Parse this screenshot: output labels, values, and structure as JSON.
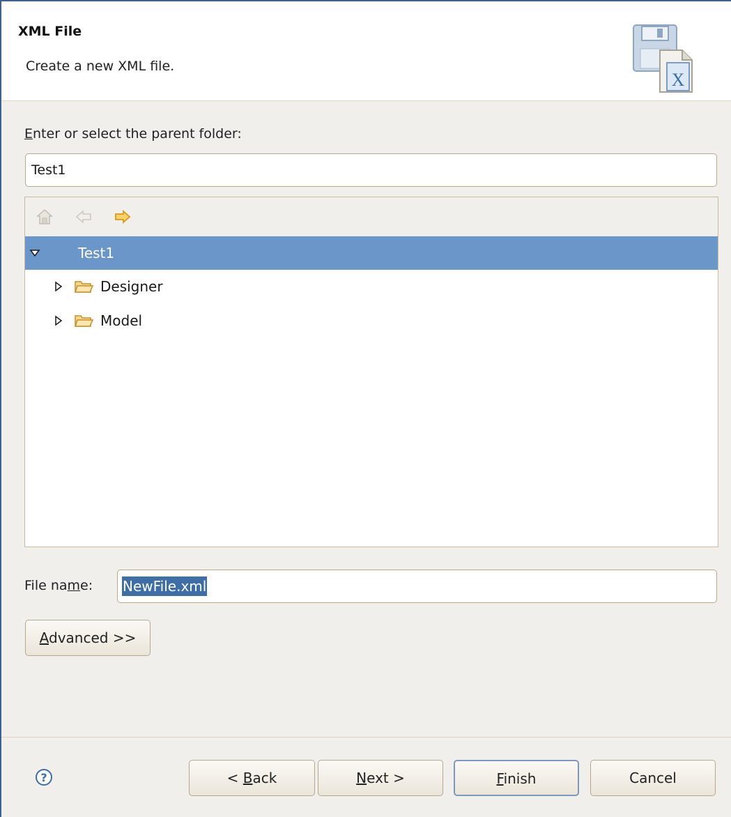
{
  "banner": {
    "title": "XML File",
    "description": "Create a new XML file.",
    "icon": "xml-file-wizard-icon"
  },
  "parent_folder": {
    "label_prefix": "",
    "label_mnemonic": "E",
    "label_rest": "nter or select the parent folder:",
    "value": "Test1"
  },
  "tree": {
    "toolbar": {
      "home_icon": "home-icon",
      "back_icon": "back-arrow-icon",
      "forward_icon": "forward-arrow-icon"
    },
    "items": [
      {
        "label": "Test1",
        "expanded": true,
        "selected": true
      },
      {
        "label": "Designer",
        "expanded": false,
        "selected": false
      },
      {
        "label": "Model",
        "expanded": false,
        "selected": false
      }
    ]
  },
  "file_name": {
    "label_prefix": "File na",
    "label_mnemonic": "m",
    "label_rest": "e:",
    "value": "NewFile.xml"
  },
  "buttons": {
    "advanced_mn": "A",
    "advanced_rest": "dvanced >>",
    "back_prefix": "< ",
    "back_mn": "B",
    "back_rest": "ack",
    "next_mn": "N",
    "next_rest": "ext >",
    "finish_mn": "F",
    "finish_rest": "inish",
    "cancel": "Cancel"
  },
  "colors": {
    "selection": "#6a96c9",
    "text_selection": "#3d6ea8",
    "window_border": "#3e6290"
  }
}
